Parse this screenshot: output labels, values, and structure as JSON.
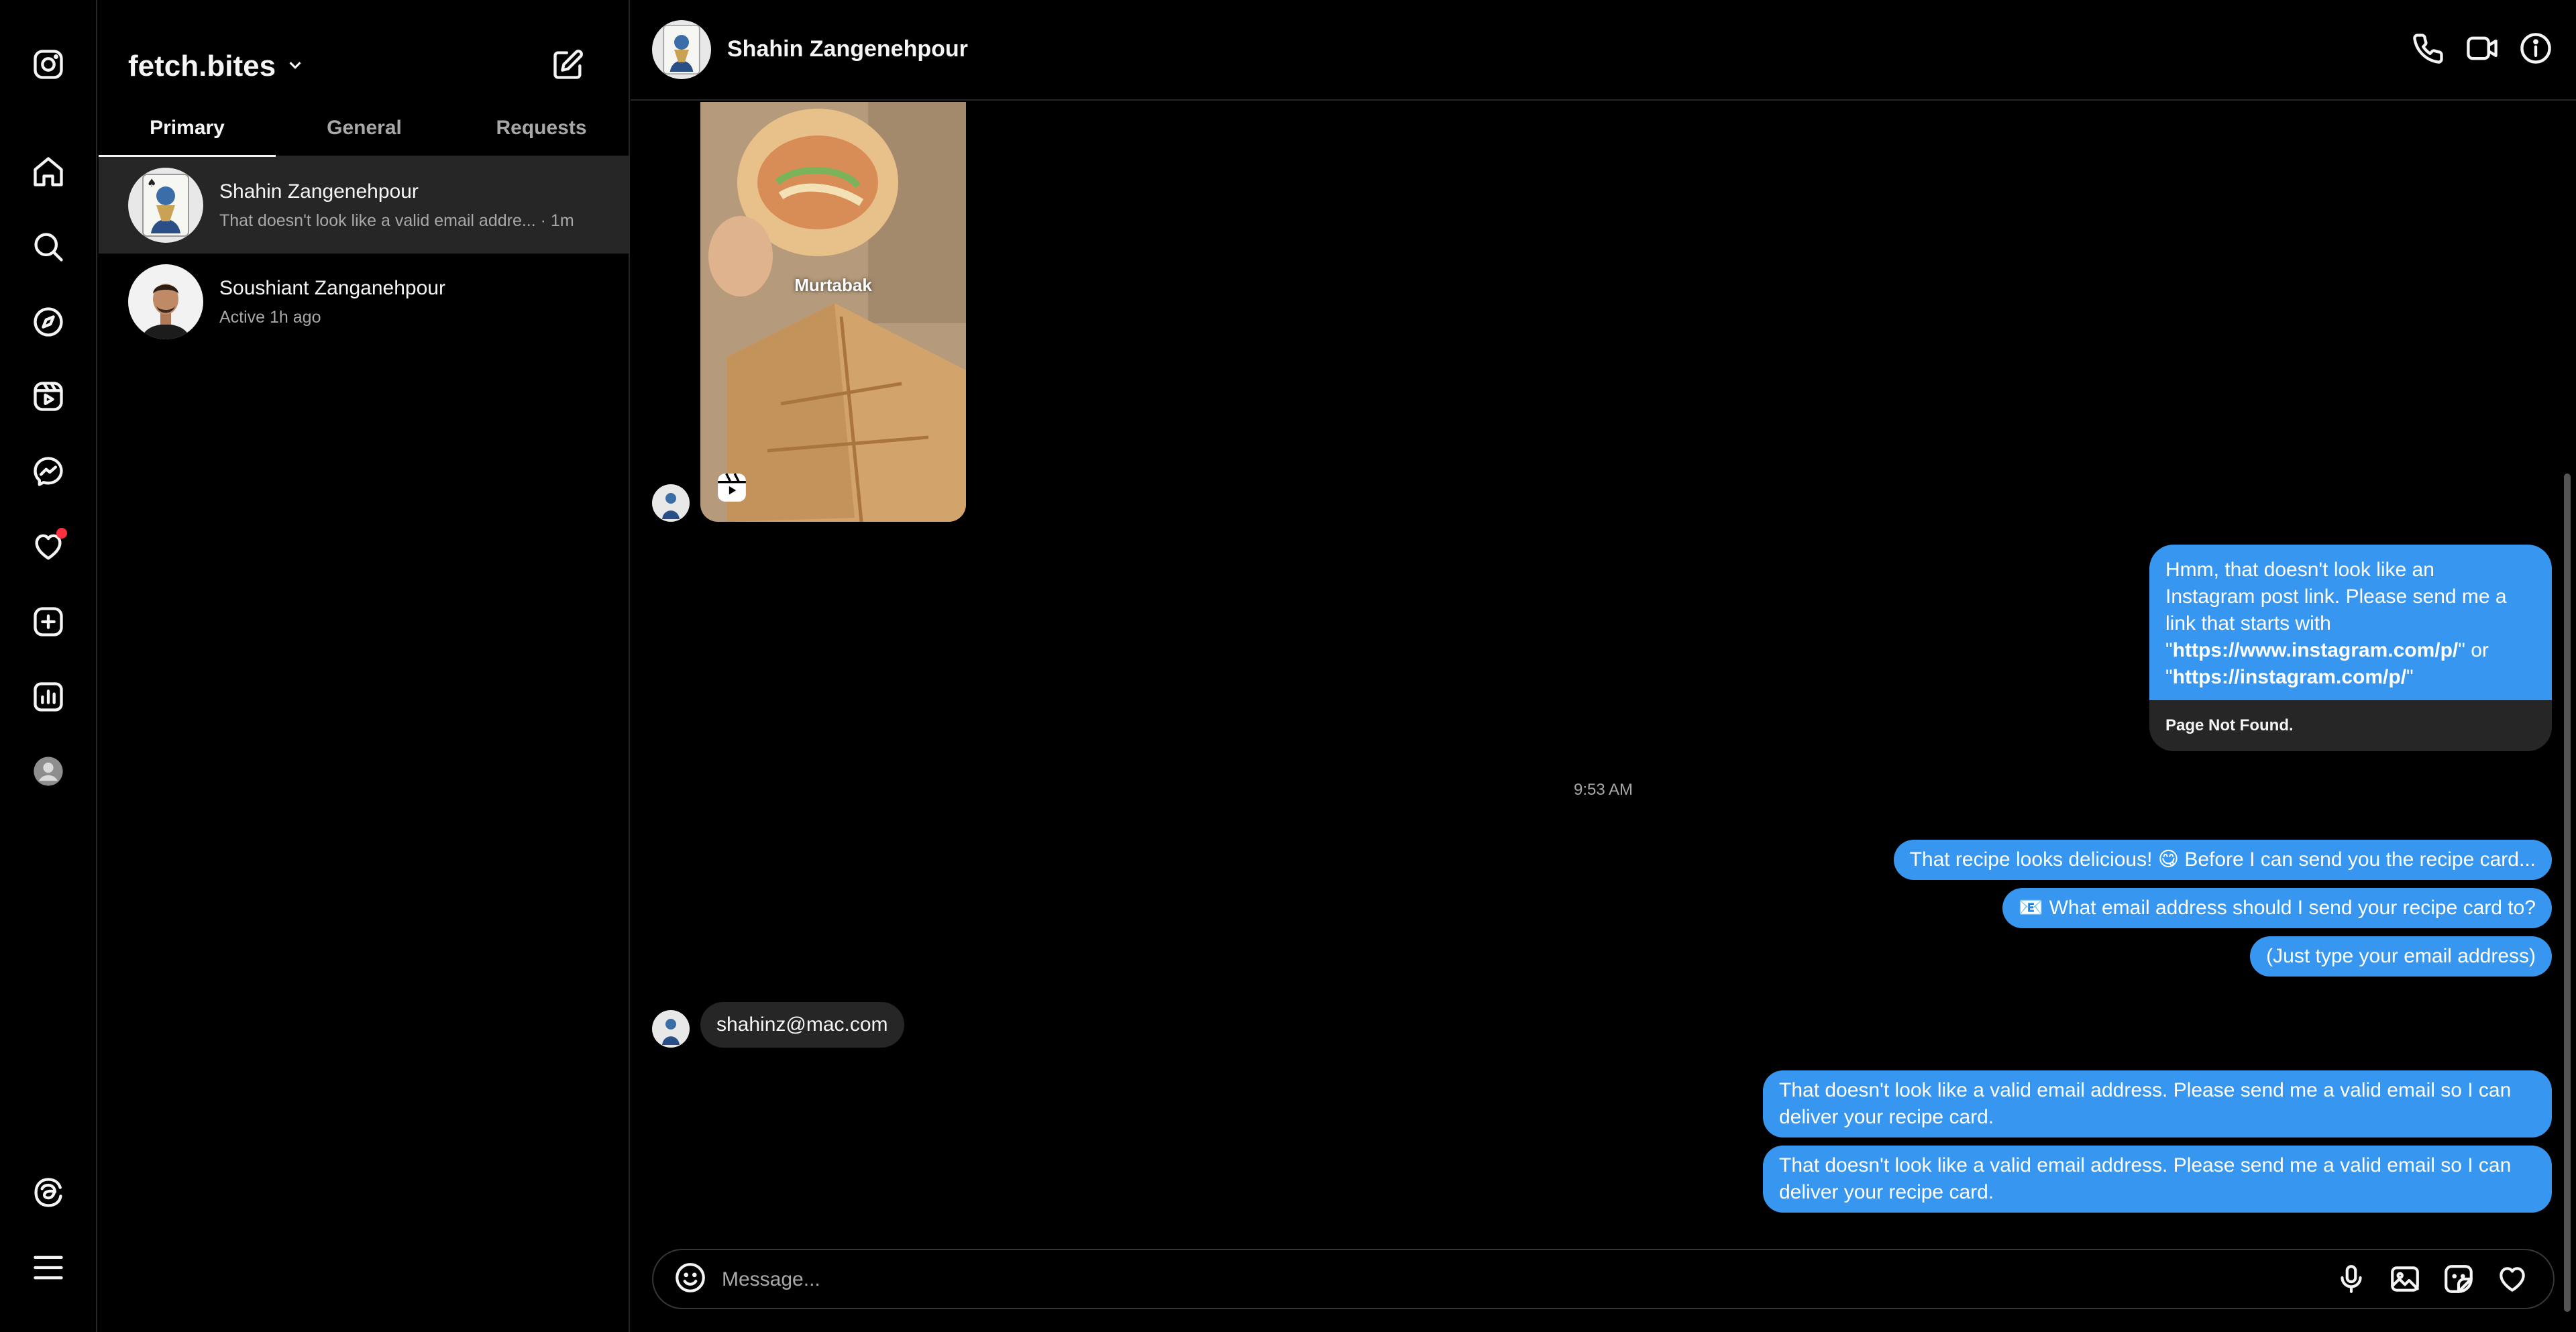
{
  "sidebar_icons": [
    "instagram-icon",
    "home-icon",
    "search-icon",
    "explore-icon",
    "reels-icon",
    "messenger-icon",
    "notifications-icon",
    "create-icon",
    "dashboard-icon",
    "profile-icon",
    "threads-icon",
    "menu-icon"
  ],
  "inbox": {
    "account_name": "fetch.bites",
    "tabs": [
      {
        "label": "Primary",
        "active": true
      },
      {
        "label": "General",
        "active": false
      },
      {
        "label": "Requests",
        "active": false
      }
    ],
    "threads": [
      {
        "name": "Shahin Zangenehpour",
        "preview": "That doesn't look like a valid email addre... · 1m",
        "selected": true
      },
      {
        "name": "Soushiant Zanganehpour",
        "preview": "Active 1h ago",
        "selected": false
      }
    ]
  },
  "chat": {
    "contact_name": "Shahin Zangenehpour",
    "reel": {
      "caption": "Murtabak"
    },
    "card": {
      "text_1": "Hmm, that doesn't look like an",
      "text_2": "Instagram post link. Please send me a",
      "text_3": "link that starts with",
      "quote_open": "\"",
      "link_1": "https://www.instagram.com/p/",
      "text_or": "\" or",
      "link_2": "https://instagram.com/p/",
      "quote_close": "\"",
      "footer": "Page Not Found."
    },
    "timestamp": "9:53 AM",
    "outgoing_1": "That recipe looks delicious! 😋 Before I can send you the recipe card...",
    "outgoing_2": "📧 What email address should I send your recipe card to?",
    "outgoing_3": "(Just type your email address)",
    "incoming_email": "shahinz@mac.com",
    "error_1_line_1": "That doesn't look like a valid email address. Please send me a valid email so I can",
    "error_1_line_2": "deliver your recipe card.",
    "error_2_line_1": "That doesn't look like a valid email address. Please send me a valid email so I can",
    "error_2_line_2": "deliver your recipe card."
  },
  "composer": {
    "placeholder": "Message..."
  },
  "colors": {
    "outgoing_bubble": "#3797f0",
    "incoming_bubble": "#262626",
    "background": "#000000",
    "notification_dot": "#ff3040"
  }
}
